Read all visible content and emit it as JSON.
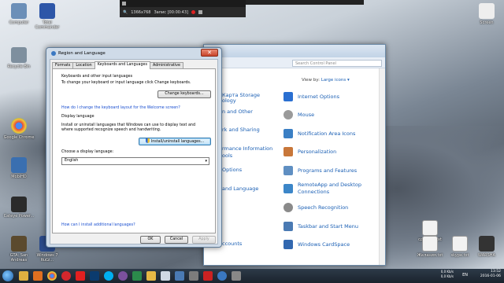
{
  "recorder": {
    "resolution": "1366x768",
    "status_label": "Запис [00:00:43]"
  },
  "desktop_icons": [
    {
      "label": "Computer",
      "color": "#6b8fb8"
    },
    {
      "label": "Google Chrome",
      "color": "#3a9d3a"
    },
    {
      "label": "MobiHD",
      "color": "#3a6fb0"
    },
    {
      "label": "Cateye Power...",
      "color": "#2b2b2b"
    },
    {
      "label": "Recycle Bin",
      "color": "#7e8f9e"
    },
    {
      "label": "Total Commander",
      "color": "#2d56a8"
    },
    {
      "label": "Windows 7 RuGi...",
      "color": "#2c4c8c"
    },
    {
      "label": "GTA: San Andreas",
      "color": "#5b4a2e"
    },
    {
      "label": "сделать.txt",
      "color": "#f2f2f2"
    },
    {
      "label": "Желания.txt",
      "color": "#f2f2f2"
    },
    {
      "label": "skype.txt",
      "color": "#f2f2f2"
    },
    {
      "label": "WARSHA",
      "color": "#333"
    },
    {
      "label": "Screen",
      "color": "#eeeeee"
    }
  ],
  "control_panel": {
    "search_placeholder": "Search Control Panel",
    "view_by_label": "View by:",
    "view_by_value": "Large icons ▾",
    "left_items": [
      "Карта Storage",
      "ology",
      "n and Other",
      "rk and Sharing",
      "rmance Information",
      "ools",
      "Options",
      "and Language",
      "ccounts"
    ],
    "items": [
      {
        "label": "Internet Options",
        "color": "#2a6fd1"
      },
      {
        "label": "Mouse",
        "color": "#9a9a9a"
      },
      {
        "label": "Notification Area Icons",
        "color": "#3b7fc4"
      },
      {
        "label": "Personalization",
        "color": "#c8773a"
      },
      {
        "label": "Programs and Features",
        "color": "#5f8fc2"
      },
      {
        "label": "RemoteApp and Desktop Connections",
        "color": "#3c86c8"
      },
      {
        "label": "Speech Recognition",
        "color": "#8a8a8a"
      },
      {
        "label": "Taskbar and Start Menu",
        "color": "#4a7ab3"
      },
      {
        "label": "Windows CardSpace",
        "color": "#3268b0"
      }
    ]
  },
  "dialog": {
    "title": "Region and Language",
    "close_glyph": "✕",
    "tabs": [
      "Formats",
      "Location",
      "Keyboards and Languages",
      "Administrative"
    ],
    "active_tab": 2,
    "keyboards": {
      "group_title": "Keyboards and other input languages",
      "description": "To change your keyboard or input language click Change keyboards.",
      "change_button": "Change keyboards...",
      "welcome_link": "How do I change the keyboard layout for the Welcome screen?"
    },
    "display_language": {
      "group_title": "Display language",
      "description_line1": "Install or uninstall languages that Windows can use to display text and",
      "description_line2": "where supported recognize speech and handwriting.",
      "install_button": "Install/uninstall languages...",
      "choose_label": "Choose a display language:",
      "selected_language": "English"
    },
    "install_link": "How can I install additional languages?",
    "ok_label": "OK",
    "cancel_label": "Cancel",
    "apply_label": "Apply"
  },
  "taskbar": {
    "language": "EN",
    "network_up": "0,0 Kb/s",
    "network_down": "0,0 Kb/s",
    "time": "13:52",
    "date": "2016-01-06"
  }
}
